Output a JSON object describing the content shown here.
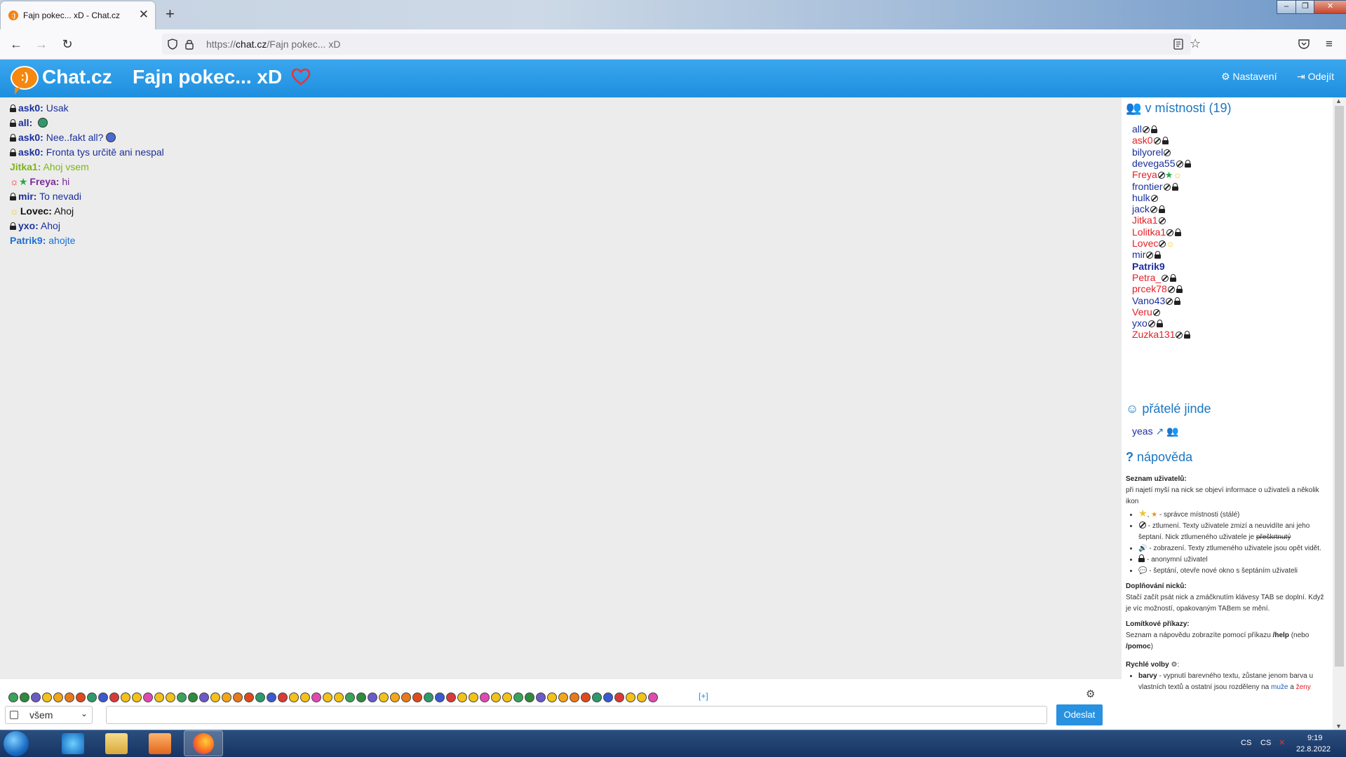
{
  "browser": {
    "tab_title": "Fajn pokec... xD - Chat.cz",
    "tab_close": "✕",
    "new_tab": "+",
    "url_prefix": "https://",
    "url_host": "chat.cz",
    "url_path": "/Fajn pokec... xD"
  },
  "header": {
    "logo_face": ":)",
    "logo_text": "Chat.cz",
    "room_title": "Fajn pokec... xD",
    "settings_label": "Nastavení",
    "logout_label": "Odejít"
  },
  "messages": [
    {
      "nick": "ask0:",
      "text": "Usak",
      "color": "#1a2f9c",
      "badge": "lock"
    },
    {
      "nick": "all:",
      "text": "",
      "color": "#1a2f9c",
      "badge": "lock",
      "emoticon": "smiley-icon"
    },
    {
      "nick": "ask0:",
      "text": "Nee..fakt all?",
      "color": "#1a2f9c",
      "badge": "lock",
      "emoticon": "smiley-icon"
    },
    {
      "nick": "ask0:",
      "text": "Fronta tys určitě ani nespal",
      "color": "#1a2f9c",
      "badge": "lock"
    },
    {
      "nick": "Jitka1:",
      "text": "Ahoj vsem",
      "color": "#7cb518",
      "badge": ""
    },
    {
      "nick": "Freya:",
      "text": "hi",
      "color": "#7a2a9a",
      "badge": "admin"
    },
    {
      "nick": "mir:",
      "text": "To nevadi",
      "color": "#1a2f9c",
      "badge": "lock"
    },
    {
      "nick": "Lovec:",
      "text": "Ahoj",
      "color": "#111111",
      "badge": "sun"
    },
    {
      "nick": "yxo:",
      "text": "Ahoj",
      "color": "#1a2f9c",
      "badge": "lock"
    },
    {
      "nick": "Patrik9:",
      "text": "ahojte",
      "color": "#1c6fd6",
      "badge": ""
    }
  ],
  "input": {
    "recipient": "všem",
    "more_emoticons": "[+]",
    "send_label": "Odeslat"
  },
  "sidebar": {
    "users_title": "v místnosti (19)",
    "users": [
      {
        "name": "all",
        "color": "blue",
        "muted": true,
        "lock": true
      },
      {
        "name": "ask0",
        "color": "red",
        "muted": true,
        "lock": true
      },
      {
        "name": "bilyorel",
        "color": "blue",
        "muted": true,
        "lock": false
      },
      {
        "name": "devega55",
        "color": "blue",
        "muted": true,
        "lock": true
      },
      {
        "name": "Freya",
        "color": "red",
        "muted": true,
        "lock": false,
        "star": true,
        "sun": true
      },
      {
        "name": "frontier",
        "color": "blue",
        "muted": true,
        "lock": true
      },
      {
        "name": "hulk",
        "color": "blue",
        "muted": true,
        "lock": false
      },
      {
        "name": "jack",
        "color": "blue",
        "muted": true,
        "lock": true
      },
      {
        "name": "Jitka1",
        "color": "red",
        "muted": true,
        "lock": false
      },
      {
        "name": "Lolitka1",
        "color": "red",
        "muted": true,
        "lock": true
      },
      {
        "name": "Lovec",
        "color": "red",
        "muted": true,
        "lock": false,
        "sun": true
      },
      {
        "name": "mir",
        "color": "blue",
        "muted": true,
        "lock": true
      },
      {
        "name": "Patrik9",
        "color": "blue",
        "muted": false,
        "lock": false,
        "bold": true
      },
      {
        "name": "Petra_",
        "color": "red",
        "muted": true,
        "lock": true
      },
      {
        "name": "prcek78",
        "color": "red",
        "muted": true,
        "lock": true
      },
      {
        "name": "Vano43",
        "color": "blue",
        "muted": true,
        "lock": true
      },
      {
        "name": "Veru",
        "color": "red",
        "muted": true,
        "lock": false
      },
      {
        "name": "yxo",
        "color": "blue",
        "muted": true,
        "lock": true
      },
      {
        "name": "Zuzka131",
        "color": "red",
        "muted": true,
        "lock": true
      }
    ],
    "friends_title": "přátelé jinde",
    "friends": [
      {
        "name": "yeas"
      }
    ],
    "help_title": "nápověda",
    "help": {
      "users_heading": "Seznam uživatelů:",
      "users_text": "při najetí myší na nick se objeví informace o uživateli a několik ikon",
      "items": [
        "- správce místnosti (stálé)",
        "- ztlumení. Texty uživatele zmizí a neuvidíte ani jeho šeptaní. Nick ztlumeného uživatele je",
        "- zobrazení. Texty ztlumeného uživatele jsou opět vidět.",
        "- anonymní uživatel",
        "- šeptání, otevře nové okno s šeptáním uživateli"
      ],
      "strikethrough_word": "přeškrtnutý",
      "nick_heading": "Doplňování nicků:",
      "nick_text": "Stačí začít psát nick a zmáčknutím klávesy TAB se doplní. Když je víc možností, opakovaným TABem se mění.",
      "slash_heading": "Lomítkové příkazy:",
      "slash_text_1": "Seznam a nápovědu zobrazíte pomocí příkazu ",
      "slash_cmd_1": "/help",
      "slash_text_2": " (nebo ",
      "slash_cmd_2": "/pomoc",
      "slash_text_3": ")",
      "quick_heading": "Rychlé volby",
      "quick_item_bold": "barvy",
      "quick_item_text": " - vypnutí barevného textu, zůstane jenom barva u vlastních textů a ostatní jsou rozděleny na ",
      "quick_link_1": "muže",
      "quick_and": " a ",
      "quick_link_2": "ženy"
    }
  },
  "taskbar": {
    "lang_1": "CS",
    "lang_2": "CS",
    "time": "9:19",
    "date": "22.8.2022"
  },
  "colors": {
    "header_blue": "#2a9be6",
    "link_blue": "#1b76c2",
    "send_button": "#2891e0"
  }
}
